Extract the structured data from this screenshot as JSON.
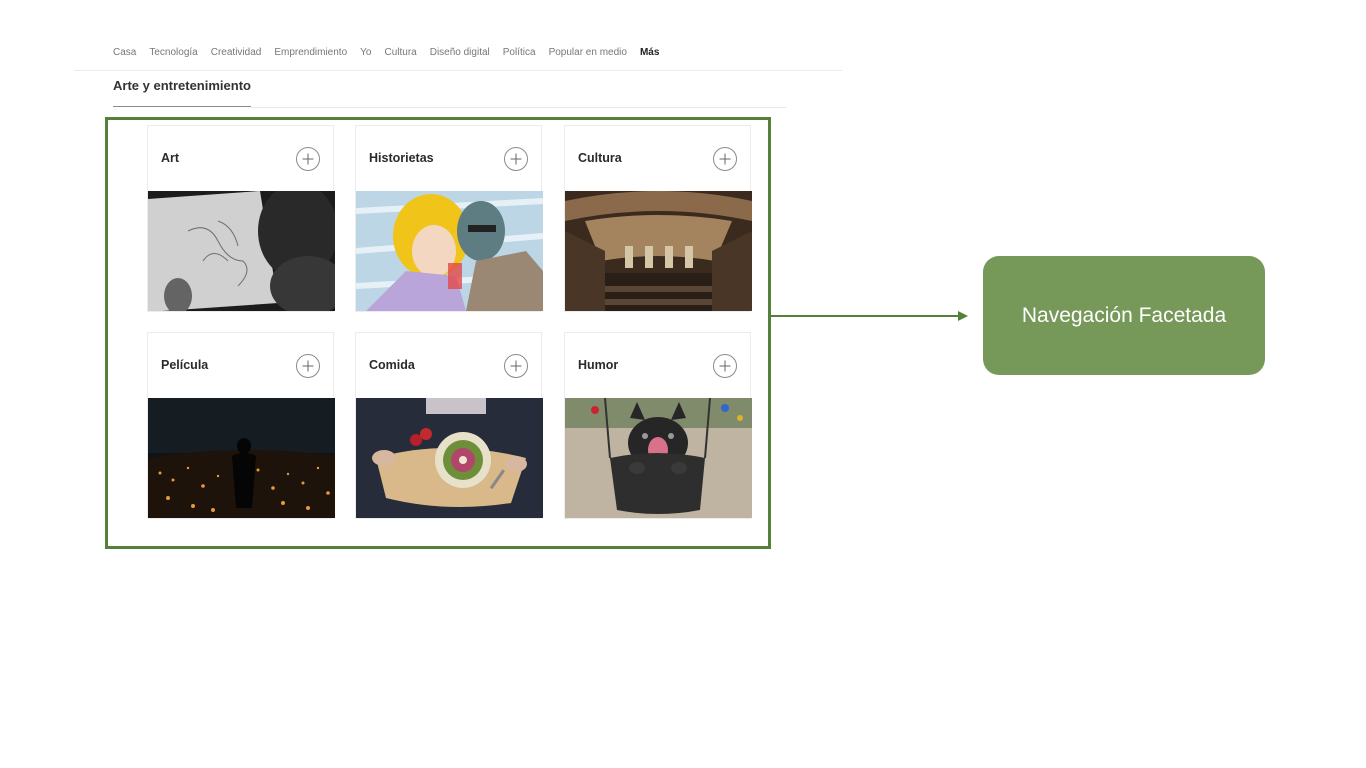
{
  "nav": {
    "items": [
      "Casa",
      "Tecnología",
      "Creatividad",
      "Emprendimiento",
      "Yo",
      "Cultura",
      "Diseño digital",
      "Política",
      "Popular en medio",
      "Más"
    ]
  },
  "section": {
    "title": "Arte y entretenimiento"
  },
  "cards": [
    {
      "label": "Art",
      "image": "drawing-photo"
    },
    {
      "label": "Historietas",
      "image": "comic-photo"
    },
    {
      "label": "Cultura",
      "image": "library-photo"
    },
    {
      "label": "Película",
      "image": "night-city-photo"
    },
    {
      "label": "Comida",
      "image": "food-photo"
    },
    {
      "label": "Humor",
      "image": "dog-photo"
    }
  ],
  "callout": {
    "text": "Navegación Facetada"
  },
  "colors": {
    "accent": "#55803a",
    "callout_bg": "#76995a"
  }
}
